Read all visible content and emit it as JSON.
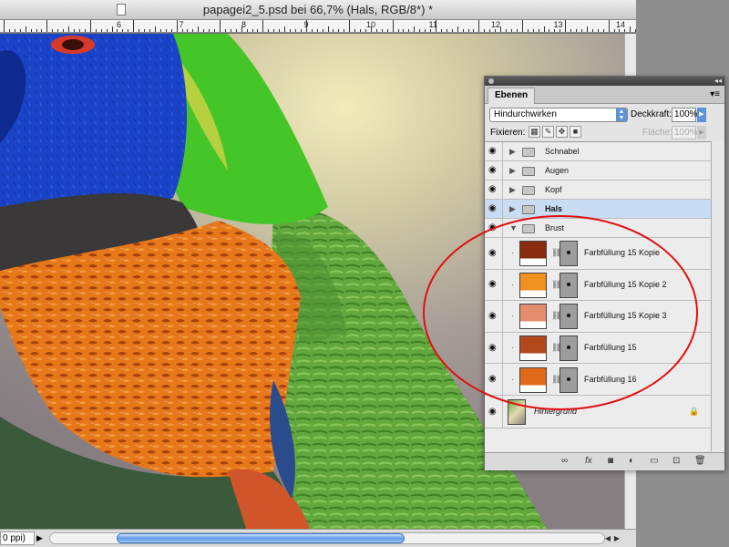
{
  "window": {
    "title": "papagei2_5.psd bei 66,7% (Hals, RGB/8*) *",
    "zoom": "0 ppi)",
    "ruler_numbers": [
      "6",
      "7",
      "8",
      "9",
      "10",
      "11",
      "12",
      "13",
      "14"
    ]
  },
  "panel": {
    "tab_label": "Ebenen",
    "blend_mode": "Hindurchwirken",
    "opacity_label": "Deckkraft:",
    "opacity_value": "100%",
    "lock_label": "Fixieren:",
    "fill_label": "Fläche:",
    "fill_value": "100%",
    "layers": [
      {
        "kind": "group",
        "name": "Schnabel",
        "expanded": false,
        "selected": false
      },
      {
        "kind": "group",
        "name": "Augen",
        "expanded": false,
        "selected": false
      },
      {
        "kind": "group",
        "name": "Kopf",
        "expanded": false,
        "selected": false
      },
      {
        "kind": "group",
        "name": "Hals",
        "expanded": false,
        "selected": true
      },
      {
        "kind": "group",
        "name": "Brust",
        "expanded": true,
        "selected": false
      },
      {
        "kind": "fill",
        "name": "Farbfüllung 15 Kopie",
        "color": "#8a2a0e"
      },
      {
        "kind": "fill",
        "name": "Farbfüllung 15 Kopie 2",
        "color": "#f09020"
      },
      {
        "kind": "fill",
        "name": "Farbfüllung 15 Kopie 3",
        "color": "#e38c6e"
      },
      {
        "kind": "fill",
        "name": "Farbfüllung 15",
        "color": "#b2481c"
      },
      {
        "kind": "fill",
        "name": "Farbfüllung 16",
        "color": "#e06a1a"
      },
      {
        "kind": "background",
        "name": "Hintergrund"
      }
    ],
    "bottom_icons": [
      "link-icon",
      "fx-icon",
      "mask-icon",
      "adjustment-icon",
      "folder-icon",
      "new-layer-icon",
      "trash-icon"
    ]
  },
  "colors": {
    "selection_blue": "#c8dcf4",
    "highlight_circle": "#e01010",
    "parrot_blue": "#1a3fc4",
    "parrot_green": "#3fc426",
    "parrot_orange": "#e87417"
  }
}
